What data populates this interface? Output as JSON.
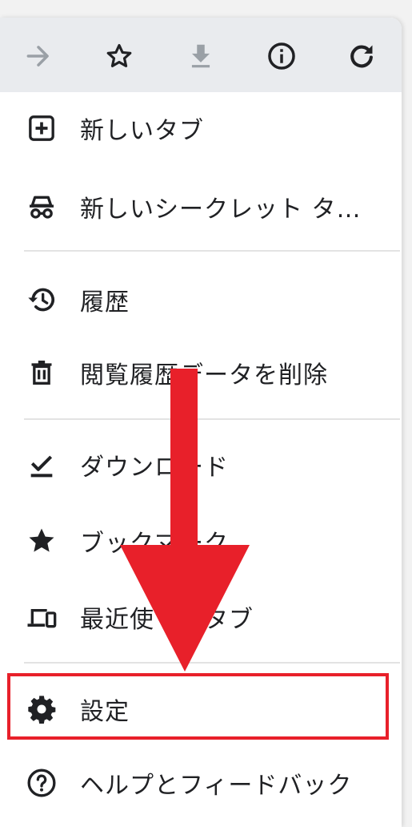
{
  "toolbar": {
    "icons": [
      "forward-icon",
      "bookmark-star-icon",
      "download-icon",
      "info-icon",
      "reload-icon"
    ]
  },
  "menu": {
    "new_tab": "新しいタブ",
    "incognito_tab": "新しいシークレット タ…",
    "history": "履歴",
    "clear_browsing_data": "閲覧履歴データを削除",
    "downloads": "ダウンロード",
    "bookmarks": "ブックマーク",
    "recent_tabs": "最近使ったタブ",
    "settings": "設定",
    "help_feedback": "ヘルプとフィードバック"
  },
  "colors": {
    "toolbar_bg": "#e9ebee",
    "icon_dark": "#202124",
    "icon_disabled": "#9aa0a6",
    "annotation_red": "#e8202a"
  }
}
